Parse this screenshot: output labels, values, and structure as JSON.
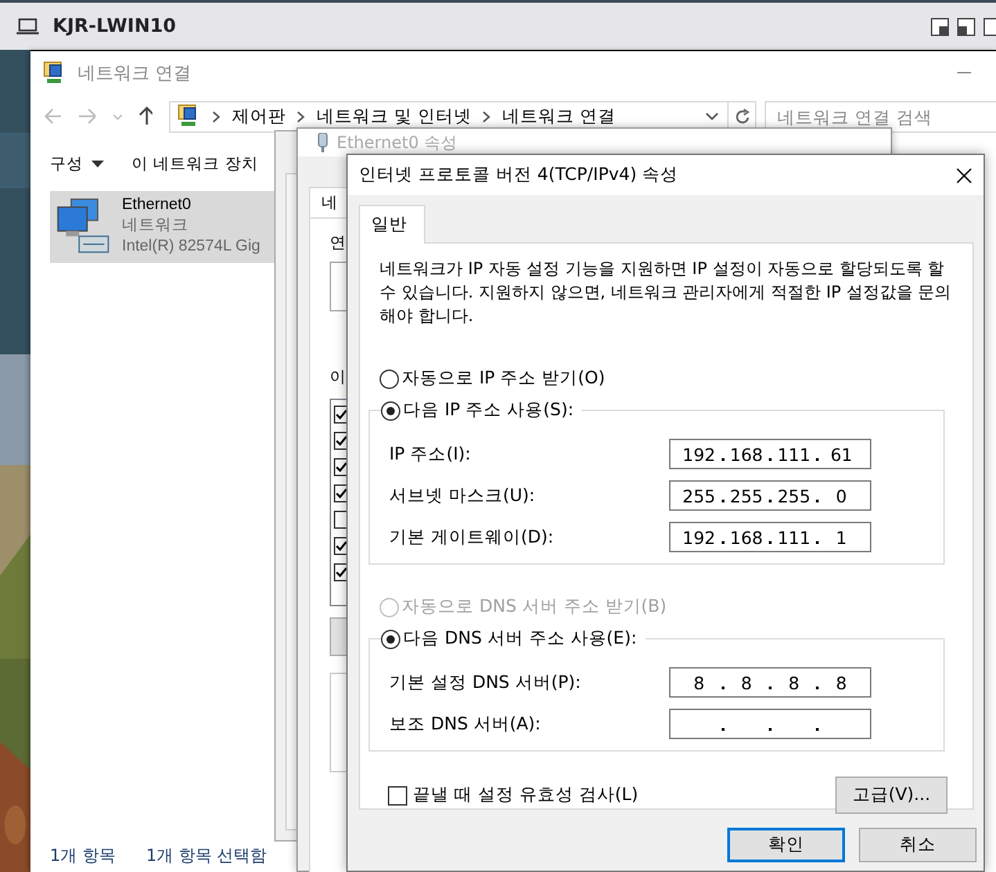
{
  "host_window": {
    "title": "KJR-LWIN10"
  },
  "explorer": {
    "title": "네트워크 연결",
    "breadcrumb": [
      "제어판",
      "네트워크 및 인터넷",
      "네트워크 연결"
    ],
    "search": {
      "placeholder": "네트워크 연결 검색"
    },
    "toolbar": [
      {
        "label": "구성",
        "dropdown": true
      },
      {
        "label": "이 네트워크 장치",
        "dropdown": false
      }
    ],
    "items": [
      {
        "name": "Ethernet0",
        "status": "네트워크",
        "adapter": "Intel(R) 82574L Gig",
        "selected": true
      }
    ],
    "status_bar": [
      "1개 항목",
      "1개 항목 선택함"
    ]
  },
  "adapter_dialog": {
    "title": "Ethernet0 속성",
    "tab": "네",
    "label_1": "연",
    "label_2": "이",
    "components": [
      {
        "checked": true
      },
      {
        "checked": true
      },
      {
        "checked": true
      },
      {
        "checked": true
      },
      {
        "checked": false
      },
      {
        "checked": true
      },
      {
        "checked": true
      }
    ]
  },
  "ipv4_dialog": {
    "title": "인터넷 프로토콜 버전 4(TCP/IPv4) 속성",
    "tab": {
      "label": "일반",
      "selected": true
    },
    "description": "네트워크가 IP 자동 설정 기능을 지원하면 IP 설정이 자동으로 할당되도록 할 수 있습니다. 지원하지 않으면, 네트워크 관리자에게 적절한 IP 설정값을 문의해야 합니다.",
    "ip_mode": [
      {
        "label": "자동으로 IP 주소 받기(O)",
        "selected": false,
        "disabled": false
      },
      {
        "label": "다음 IP 주소 사용(S):",
        "selected": true,
        "disabled": false
      }
    ],
    "ip_fields": [
      {
        "label": "IP 주소(I):",
        "octets": [
          "192",
          "168",
          "111",
          "61"
        ]
      },
      {
        "label": "서브넷 마스크(U):",
        "octets": [
          "255",
          "255",
          "255",
          "0"
        ]
      },
      {
        "label": "기본 게이트웨이(D):",
        "octets": [
          "192",
          "168",
          "111",
          "1"
        ]
      }
    ],
    "dns_mode": [
      {
        "label": "자동으로 DNS 서버 주소 받기(B)",
        "selected": false,
        "disabled": true
      },
      {
        "label": "다음 DNS 서버 주소 사용(E):",
        "selected": true,
        "disabled": false
      }
    ],
    "dns_fields": [
      {
        "label": "기본 설정 DNS 서버(P):",
        "octets": [
          "8",
          "8",
          "8",
          "8"
        ]
      },
      {
        "label": "보조 DNS 서버(A):"
      }
    ],
    "validate": {
      "label": "끝낼 때 설정 유효성 검사(L)",
      "checked": false
    },
    "advanced_button": "고급(V)...",
    "buttons": [
      {
        "label": "확인",
        "default": true
      },
      {
        "label": "취소",
        "default": false
      }
    ]
  }
}
